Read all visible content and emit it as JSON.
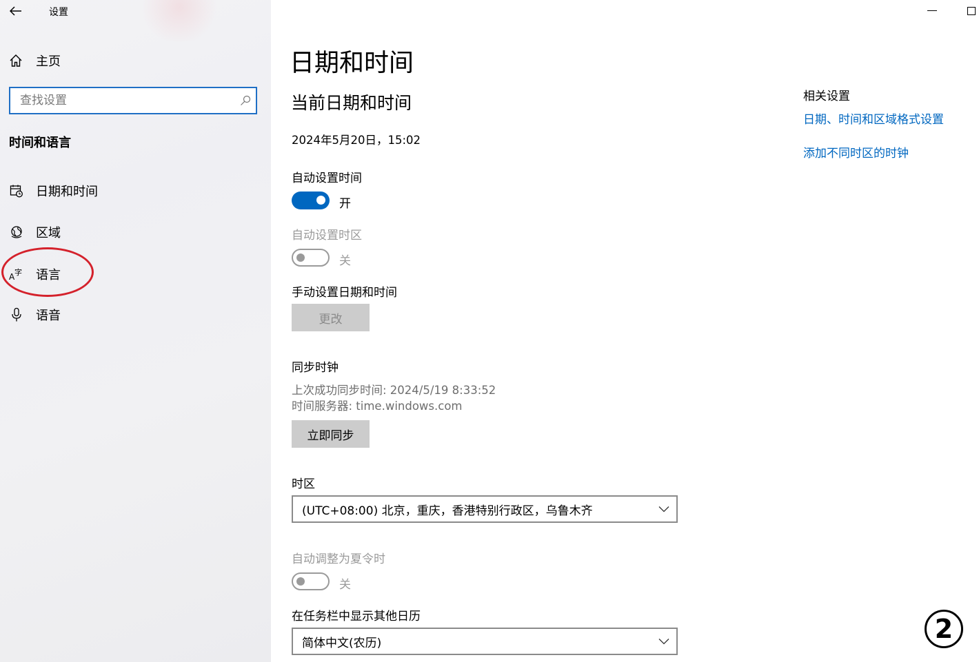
{
  "window": {
    "title": "设置"
  },
  "sidebar": {
    "home_label": "主页",
    "search": {
      "placeholder": "查找设置",
      "value": ""
    },
    "section_title": "时间和语言",
    "items": [
      {
        "label": "日期和时间",
        "icon": "calendar-clock-icon"
      },
      {
        "label": "区域",
        "icon": "globe-icon"
      },
      {
        "label": "语言",
        "icon": "language-icon"
      },
      {
        "label": "语音",
        "icon": "microphone-icon"
      }
    ]
  },
  "main": {
    "title": "日期和时间",
    "subtitle": "当前日期和时间",
    "current_datetime": "2024年5月20日，15:02",
    "auto_time": {
      "label": "自动设置时间",
      "state": "开",
      "on": true
    },
    "auto_timezone": {
      "label": "自动设置时区",
      "state": "关",
      "on": false
    },
    "manual": {
      "label": "手动设置日期和时间",
      "button": "更改"
    },
    "sync": {
      "label": "同步时钟",
      "last_sync": "上次成功同步时间: 2024/5/19 8:33:52",
      "server": "时间服务器: time.windows.com",
      "button": "立即同步"
    },
    "timezone": {
      "label": "时区",
      "value": "(UTC+08:00) 北京，重庆，香港特别行政区，乌鲁木齐"
    },
    "dst": {
      "label": "自动调整为夏令时",
      "state": "关",
      "on": false
    },
    "calendar": {
      "label": "在任务栏中显示其他日历",
      "value": "简体中文(农历)"
    }
  },
  "related": {
    "title": "相关设置",
    "links": [
      "日期、时间和区域格式设置",
      "添加不同时区的时钟"
    ]
  },
  "annotation": {
    "step": "2"
  },
  "colors": {
    "accent": "#0067c0",
    "highlight": "#d4212b"
  }
}
